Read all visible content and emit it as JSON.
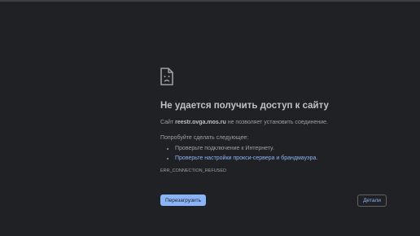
{
  "error": {
    "icon": "sad-document-icon",
    "title": "Не удается получить доступ к сайту",
    "summary_prefix": "Сайт",
    "host": "reestr.ovga.mos.ru",
    "summary_suffix": "не позволяет установить соединение.",
    "try_heading": "Попробуйте сделать следующее:",
    "suggestions": [
      "Проверьте подключение к Интернету.",
      "Проверьте настройки прокси-сервера и брандмауэра."
    ],
    "code": "ERR_CONNECTION_REFUSED"
  },
  "buttons": {
    "reload_label": "Перезагрузить",
    "details_label": "Детали"
  },
  "colors": {
    "background": "#202124",
    "accent": "#8ab4f8",
    "title": "#bdc1c6",
    "text": "#9aa0a6"
  }
}
